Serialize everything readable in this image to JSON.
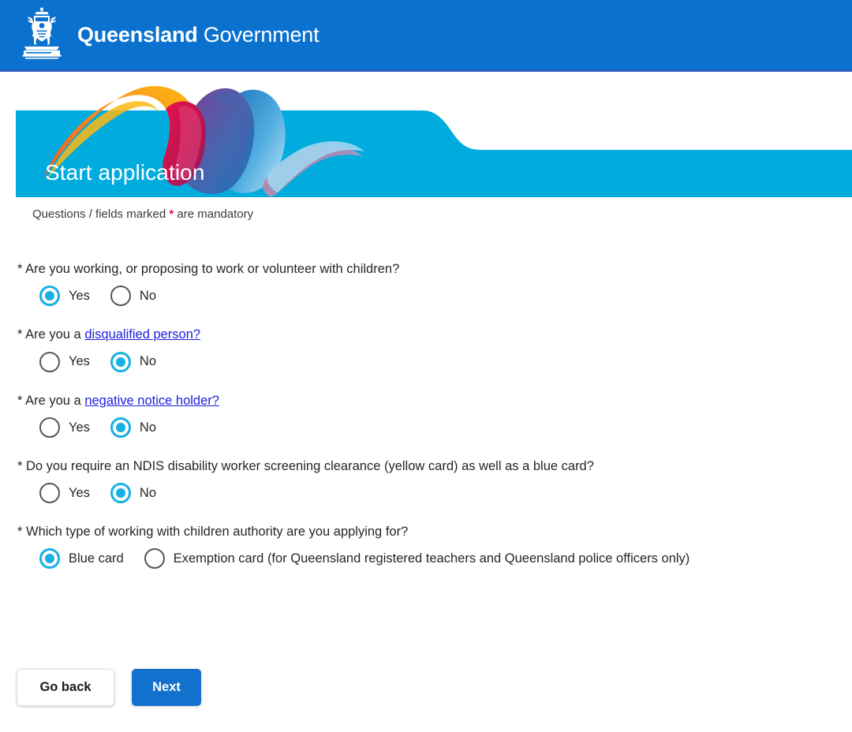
{
  "header": {
    "brand_bold": "Queensland",
    "brand_light": "Government",
    "logo_name": "queensland-coat-of-arms",
    "bg_color": "#0B71CE"
  },
  "hero": {
    "title": "Start application",
    "bg_color": "#00ACDE",
    "ribbon_name": "queensland-ribbon-graphic"
  },
  "mandatory_note": {
    "prefix": "Questions / fields marked ",
    "asterisk": "*",
    "suffix": " are mandatory",
    "asterisk_color": "#e8114b"
  },
  "form": {
    "questions": [
      {
        "label": "* Are you working, or proposing to work or volunteer with children?",
        "text_before_link": "",
        "link_text": "",
        "text_after_link": "",
        "options": [
          {
            "label": "Yes",
            "selected": true
          },
          {
            "label": "No",
            "selected": false
          }
        ]
      },
      {
        "label": "* Are you a disqualified person?",
        "text_before_link": "* Are you a ",
        "link_text": "disqualified person?",
        "text_after_link": "",
        "options": [
          {
            "label": "Yes",
            "selected": false
          },
          {
            "label": "No",
            "selected": true
          }
        ]
      },
      {
        "label": "* Are you a negative notice holder?",
        "text_before_link": "* Are you a ",
        "link_text": "negative notice holder?",
        "text_after_link": "",
        "options": [
          {
            "label": "Yes",
            "selected": false
          },
          {
            "label": "No",
            "selected": true
          }
        ]
      },
      {
        "label": "* Do you require an NDIS disability worker screening clearance (yellow card) as well as a blue card?",
        "text_before_link": "",
        "link_text": "",
        "text_after_link": "",
        "options": [
          {
            "label": "Yes",
            "selected": false
          },
          {
            "label": "No",
            "selected": true
          }
        ]
      },
      {
        "label": "* Which type of working with children authority are you applying for?",
        "text_before_link": "",
        "link_text": "",
        "text_after_link": "",
        "options": [
          {
            "label": "Blue card",
            "selected": true
          },
          {
            "label": "Exemption card (for Queensland registered teachers and Queensland police officers only)",
            "selected": false
          }
        ]
      }
    ]
  },
  "buttons": {
    "back_label": "Go back",
    "next_label": "Next",
    "next_color": "#1271cc"
  }
}
